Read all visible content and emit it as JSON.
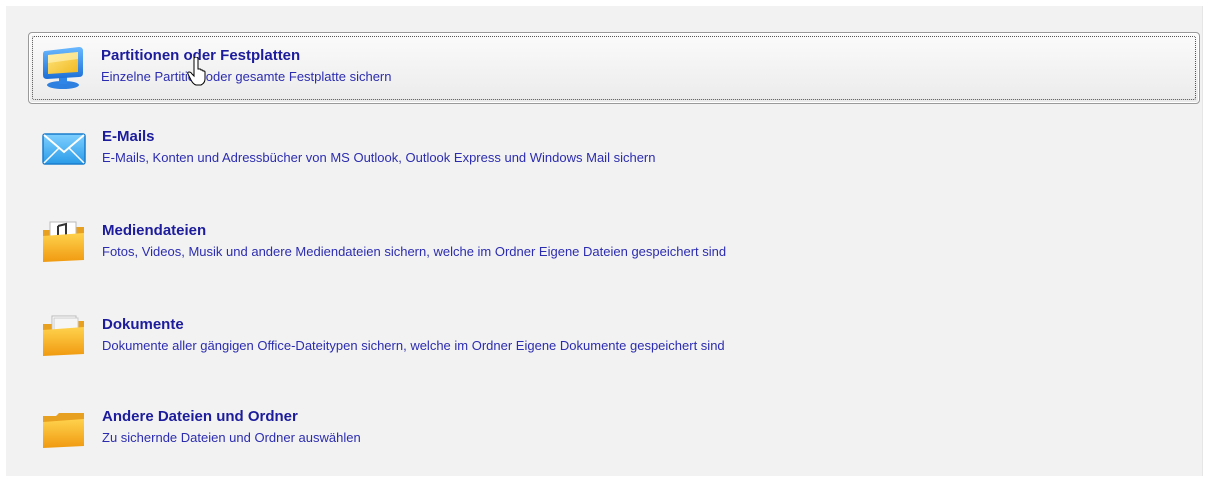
{
  "options": [
    {
      "title": "Partitionen oder Festplatten",
      "description": "Einzelne Partition oder gesamte Festplatte sichern",
      "icon": "monitor-icon",
      "selected": true
    },
    {
      "title": "E-Mails",
      "description": "E-Mails, Konten und Adressbücher von MS Outlook, Outlook Express und Windows Mail sichern",
      "icon": "envelope-icon"
    },
    {
      "title": "Mediendateien",
      "description": "Fotos, Videos, Musik und andere Mediendateien sichern, welche im Ordner Eigene Dateien gespeichert sind",
      "icon": "music-folder-icon"
    },
    {
      "title": "Dokumente",
      "description": "Dokumente aller gängigen Office-Dateitypen sichern, welche im Ordner Eigene Dokumente gespeichert sind",
      "icon": "document-folder-icon"
    },
    {
      "title": "Andere Dateien und Ordner",
      "description": "Zu sichernde Dateien und Ordner auswählen",
      "icon": "folder-icon"
    }
  ],
  "colors": {
    "title": "#1c1c9c",
    "description": "#2c2cb0",
    "panel_background": "#f2f2f2"
  }
}
